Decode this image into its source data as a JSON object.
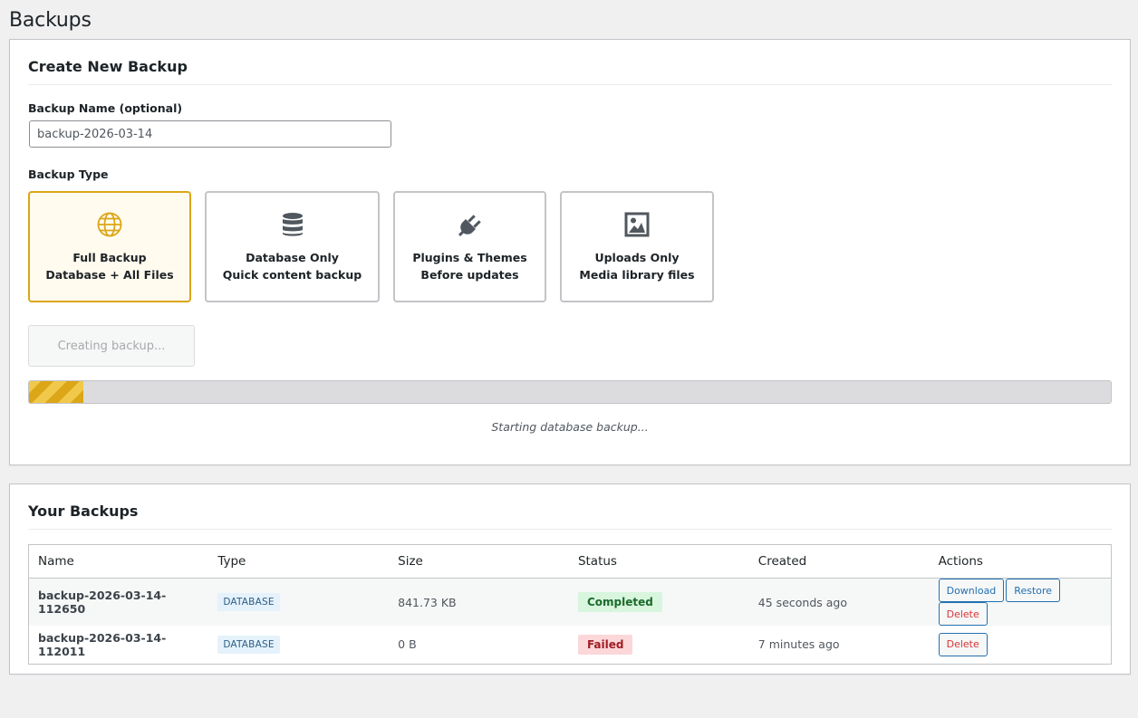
{
  "page": {
    "title": "Backups"
  },
  "create": {
    "heading": "Create New Backup",
    "name_label": "Backup Name (optional)",
    "name_value": "backup-2026-03-14",
    "type_label": "Backup Type",
    "types": [
      {
        "icon": "globe-icon",
        "title": "Full Backup",
        "subtitle": "Database + All Files",
        "selected": true
      },
      {
        "icon": "database-icon",
        "title": "Database Only",
        "subtitle": "Quick content backup",
        "selected": false
      },
      {
        "icon": "plugin-icon",
        "title": "Plugins & Themes",
        "subtitle": "Before updates",
        "selected": false
      },
      {
        "icon": "image-icon",
        "title": "Uploads Only",
        "subtitle": "Media library files",
        "selected": false
      }
    ],
    "button_label": "Creating backup...",
    "progress_fraction": 0.05,
    "progress_status": "Starting database backup..."
  },
  "list": {
    "heading": "Your Backups",
    "columns": [
      "Name",
      "Type",
      "Size",
      "Status",
      "Created",
      "Actions"
    ],
    "rows": [
      {
        "name": "backup-2026-03-14-112650",
        "type": "DATABASE",
        "size": "841.73 KB",
        "status": "Completed",
        "created": "45 seconds ago",
        "actions": [
          "Download",
          "Restore",
          "Delete"
        ]
      },
      {
        "name": "backup-2026-03-14-112011",
        "type": "DATABASE",
        "size": "0 B",
        "status": "Failed",
        "created": "7 minutes ago",
        "actions": [
          "Delete"
        ]
      }
    ]
  },
  "colors": {
    "accent": "#dba617",
    "link": "#2271b1",
    "danger": "#d63638",
    "success_bg": "#d8f5de",
    "failed_bg": "#fbd7d9",
    "icon": "#50575e"
  }
}
